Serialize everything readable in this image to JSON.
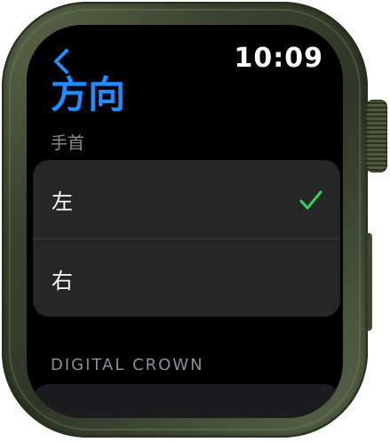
{
  "header": {
    "time": "10:09",
    "back_icon": "chevron-left-icon"
  },
  "page": {
    "title": "方向",
    "section_label": "手首"
  },
  "options": [
    {
      "label": "左",
      "selected": true
    },
    {
      "label": "右",
      "selected": false
    }
  ],
  "check_icon": "checkmark-icon",
  "section2": {
    "label": "DIGITAL CROWN"
  },
  "colors": {
    "accent": "#1f8dff",
    "check": "#35d158",
    "cell_background": "#262626",
    "secondary_text": "#8e8e93",
    "case": "#3b4430"
  }
}
